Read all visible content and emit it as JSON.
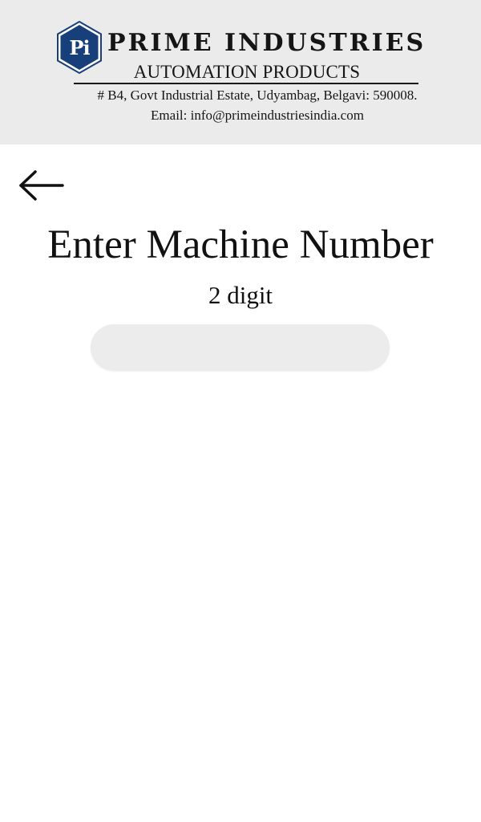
{
  "header": {
    "logo_text": "Pi",
    "company_name": "PRIME INDUSTRIES",
    "tagline": "AUTOMATION PRODUCTS",
    "address": "# B4, Govt Industrial Estate, Udyambag, Belgavi: 590008.",
    "email": "Email: info@primeindustriesindia.com",
    "colors": {
      "background": "#ebebeb",
      "logo_fill": "#173f7a",
      "logo_border": "#ffffff"
    }
  },
  "navigation": {
    "back_icon": "arrow-left-icon"
  },
  "main": {
    "title": "Enter Machine Number",
    "subtitle": "2 digit",
    "input": {
      "value": "",
      "placeholder": ""
    }
  }
}
